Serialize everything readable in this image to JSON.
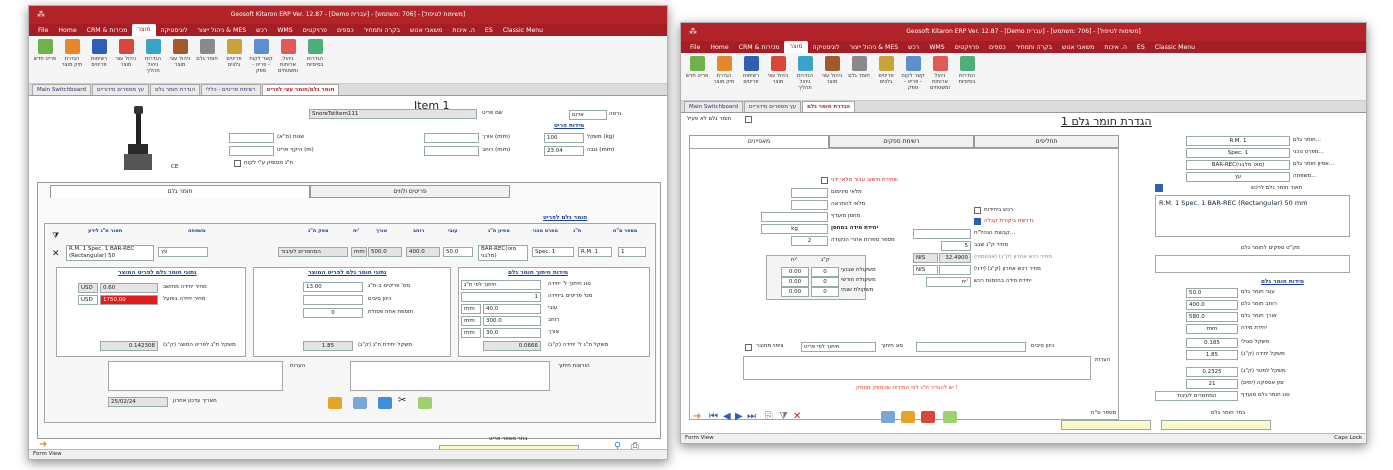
{
  "w1": {
    "title": "Geosoft Kitaron ERP Ver. 12.87 - [Demo עברית] - [706 :משתמש] - [משימות לטיפול]",
    "ribbon_tabs": [
      "File",
      "Home",
      "CRM & מכירות",
      "מוצר",
      "לוגיסטיקה",
      "ניהול ייצור & MES",
      "רכש",
      "WMS",
      "פרויקטים",
      "כספים",
      "בקרה ותמחיר",
      "משאבי אנוש",
      "ה. איכות",
      "ES",
      "Classic Menu"
    ],
    "active_tab": "מוצר",
    "ribbon_buttons": [
      "פריט חדש",
      "הגדרת תיק מוצר",
      "רשימות פריטים",
      "ניהול עצי מוצר",
      "הגדרות ניהול תהליך",
      "ניהול עצי מוצר",
      "חומר גלם",
      "פריטים גלווים",
      "קשר לקוח - פריט - ספק",
      "ניהול ארוחות ומשטחים",
      "הגדרות בסיסיות"
    ],
    "doc_tabs": [
      "Main Switchboard",
      "עץ מספרים סידוריים",
      "הגדרת חומר גלם",
      "רשימת פריטים - כללי",
      "חומר גלם/חומר עצי לפריט"
    ],
    "header_title": "Item 1",
    "item_name_label": "שם פריט",
    "item_name": "SnoreTstItem111",
    "group_label": "גרסה",
    "group_value": "אדום",
    "dims_header": "מידות פריט",
    "weight_label": "משקל (kg)",
    "weight_value": "100",
    "height_label": "גובה (mm)",
    "height_value": "23.04",
    "length_label": "אורך (mm)",
    "width_label": "רוחב (mm)",
    "unit_qty_label": "שנות (מ\"א)",
    "cust_amount_label": "היקף פריט (m)",
    "cert_label": "CE",
    "raw_check_label": "ת\"ג מסופק ע\"י לקוח",
    "sub_tabs": [
      "חומר גלם",
      "פריטים ולווים"
    ],
    "raw_header": "חומר גלם לפריט",
    "cols": [
      "מספר ס\"ח",
      "ת\"ג",
      "מפרט טכני",
      "אפיון ת\"ג",
      "עובי",
      "רוחב",
      "אורך",
      "יח'",
      "ספק ת\"ג",
      "משפחה",
      "תאור ת\"ג לידע"
    ],
    "row": {
      "num": "1",
      "rm": "R.M. 1",
      "spec": "Spec. 1",
      "bar": "BAR-REC(מוט מלבני)",
      "thick": "50.0",
      "width": "400.0",
      "length": "500.0",
      "unit": "mm",
      "supplier": "המחמרים לעיבוד",
      "family": "עץ",
      "desc": "R.M. 1 Spec. 1 BAR-REC (Rectangular) 50"
    },
    "calc_header": "מידות חיתוך חומר גלם",
    "cut_type_label": "סוג חיתוך ל' יחידה",
    "cut_type_value": "חיתוך לפי ת\"ג",
    "pieces_label": "מס' פריטים ביחידה",
    "pieces_value": "1",
    "thick_label": "עובי",
    "thick_value": "40.0",
    "width2_label": "רוחב",
    "width2_value": "300.0",
    "length2_label": "אורך",
    "length2_value": "30.0",
    "unit_mm": "mm",
    "weight_calc_label": "משקל ת\"ג ל' יחידה (ק\"ג)",
    "weight_calc_value": "0.0666",
    "mid_header": "נתוני חומר גלם לפריט המוצר",
    "units_label": "מס' פריטים ב-ת\"ג",
    "units_value": "13.00",
    "waste_label": "כיוון סיבים",
    "extra_label": "תוספת אחוז פסולת",
    "extra_value": "0",
    "weight_unit_label": "משקל יחידת ת\"ג (ק\"ג)",
    "weight_unit_value": "1.85",
    "price_header": "נתוני חומר גלם לפריט המוצר",
    "price_est_label": "מחיר יחידה מחושב",
    "price_est_currency": "USD",
    "price_est_value": "0.60",
    "price_act_label": "מחיר יחידה בפועל",
    "price_act_currency": "USD",
    "price_act_value": "1750.00",
    "item_weight_label": "משקל ת\"ג לפריט המוצר (ק\"ג)",
    "item_weight_value": "0.142308",
    "notes_label": "הערות",
    "cut_notes_label": "הוראות חיתוך",
    "date_label": "תאריך עדכון אחרון",
    "date_value": "25/02/24",
    "search_label": "בחר מספר פריט",
    "status": "Form View"
  },
  "w2": {
    "title": "Geosoft Kitaron ERP Ver. 12.87 - [Demo עברית] - [706 :משתמש] - [משימות לטיפול]",
    "ribbon_tabs": [
      "File",
      "Home",
      "CRM & מכירות",
      "מוצר",
      "לוגיסטיקה",
      "ניהול ייצור & MES",
      "רכש",
      "WMS",
      "פרויקטים",
      "כספים",
      "בקרה ותמחיר",
      "משאבי אנוש",
      "ה. איכות",
      "ES",
      "Classic Menu"
    ],
    "doc_tabs": [
      "Main Switchboard",
      "עץ מספרים סידוריים",
      "הגדרת חומר גלם"
    ],
    "active_check_label": "חומר גלם לא פעיל",
    "header_title": "הגדרת חומר גלם 1",
    "sub_tabs": [
      "מאפיינים",
      "רשימת ספקים",
      "תחליפים"
    ],
    "rm_label": "חומר גלם...",
    "rm_value": "R.M. 1",
    "spec_label": "מפרט טכני...",
    "spec_value": "Spec. 1",
    "char_label": "אפיון חומר גלם...",
    "char_value": "BAR-REC(מוט מלבני)",
    "family_label": "משפחה...",
    "family_value": "עץ",
    "desc_label": "תאור חומר גלם לרכש",
    "desc_value": "R.M. 1 Spec. 1 BAR-REC (Rectangular) 50 mm",
    "catalog_label": "מק\"ט ספקים לחומר גלם",
    "dims_header": "מידות חומר גלם",
    "thick_label": "עובי חומר גלם",
    "thick_value": "50.0",
    "width_label": "רוחב חומר גלם",
    "width_value": "400.0",
    "length_label": "אורך חומר גלם",
    "length_value": "580.0",
    "unit_label": "יחידת מידה",
    "unit_value": "mm",
    "spec_weight_label": "משקל סגולי",
    "spec_weight_value": "0.185",
    "unit_weight_label": "משקל יחידה (ק\"ג)",
    "unit_weight_value": "1.85",
    "meter_weight_label": "משקל למטר (ק\"ג)",
    "meter_weight_value": "0.2325",
    "lead_label": "זמן אספקה (ימים)",
    "lead_value": "21",
    "supplier_type_label": "סוג חומר גלם מועדף",
    "supplier_type_value": "המחמרים לעיבוד",
    "c1": [
      "רכש ביחידות",
      "נדרשת ביקורת קבלה",
      "קבוצת הנהל\"ח...",
      "מחיר ק\"ג שבב",
      "מחיר רכש אחרון (ק\"ג) (אוטומטי)",
      "מחיר רכש אחרון (ק\"ג) (ידני)",
      "יחידת מידה בהזמנת רכש"
    ],
    "chip_value": "5",
    "auto_price": "32.4900",
    "currency": "NIS",
    "order_unit": "יח'",
    "c2": [
      "שמירת חישוב עבור מלאי ידני",
      "מלאי מינימום",
      "מלאי להתראה",
      "מחסן מועדף",
      "יחידת מידה במחסן",
      "מספר ספרות אחרי הנקודה"
    ],
    "stock_unit": "kg",
    "decimals": "2",
    "stock_hdr": [
      "ק\"ג",
      "יח'"
    ],
    "stock_rows": [
      [
        "משקולת שבועי",
        "0",
        "0.00"
      ],
      [
        "משקולת חודשי",
        "0",
        "0.00"
      ],
      [
        "משקולת שנתי",
        "0",
        "0.00"
      ]
    ],
    "grain_label": "כיוון סיבים",
    "cut_type_label": "סוג חיתוך",
    "cut_type_value": "חיתוך לפי פריט",
    "must_label": "ציפוי מחובר",
    "notes_label": "הערות",
    "warning": "יש להגדיר ת\"ג לפי המידות שהספק מספק !",
    "search_label": "בחר חומר גלם",
    "search_label2": "מספר ס\"ח",
    "status": "Form View",
    "caps": "Caps Lock"
  },
  "colors": {
    "red": "#b3232a",
    "accent": "#1c3f9a"
  }
}
